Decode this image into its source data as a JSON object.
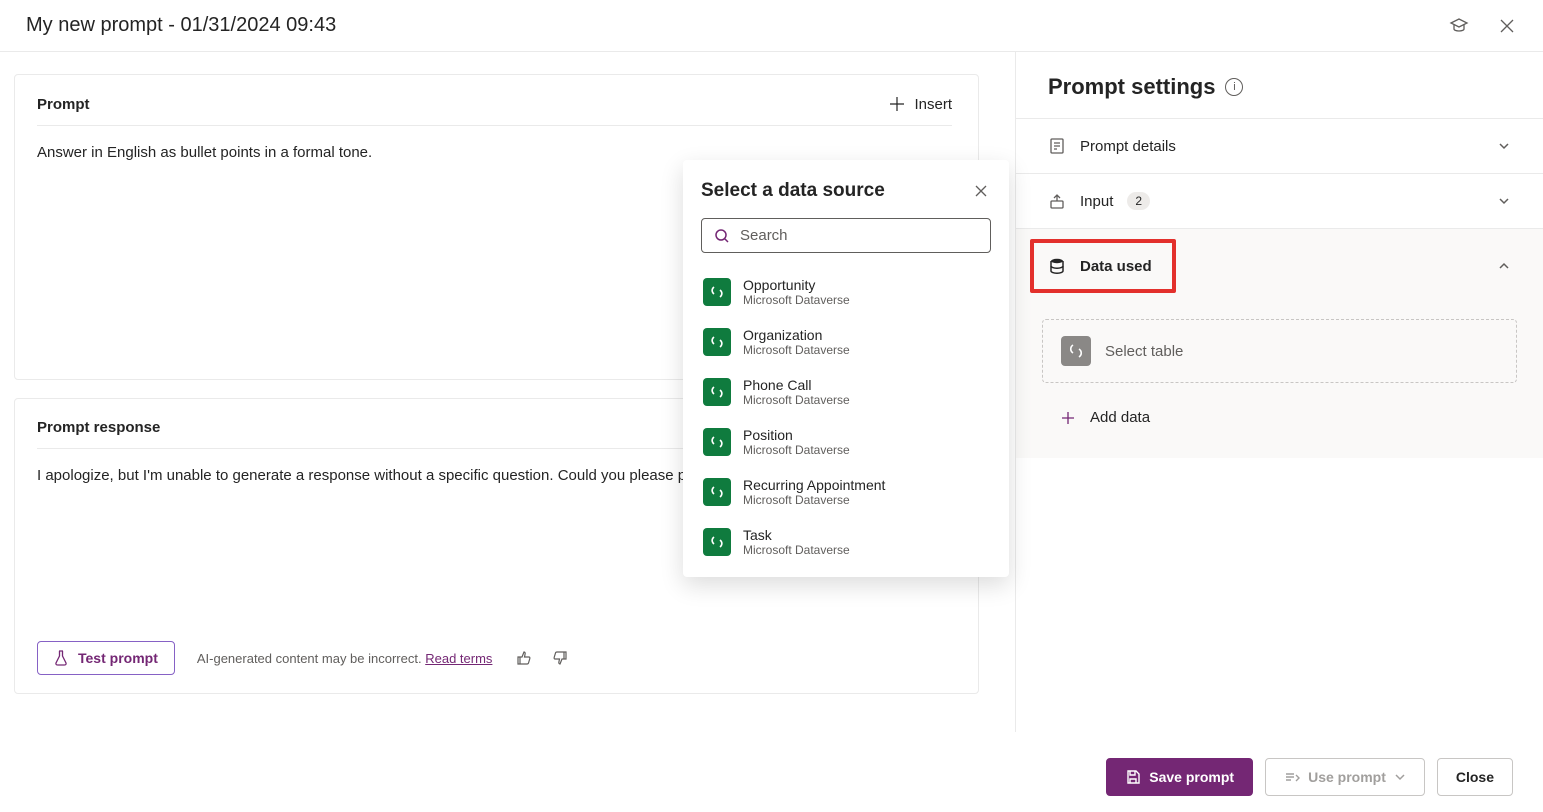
{
  "header": {
    "title": "My new prompt - 01/31/2024 09:43"
  },
  "prompt_section": {
    "title": "Prompt",
    "insert_label": "Insert",
    "text": "Answer in English as bullet points in a formal tone."
  },
  "response_section": {
    "title": "Prompt response",
    "text": "I apologize, but I'm unable to generate a response without a specific question. Could you please provide",
    "test_label": "Test prompt",
    "disclaimer": "AI-generated content may be incorrect.",
    "read_terms": "Read terms"
  },
  "settings": {
    "title": "Prompt settings",
    "details_label": "Prompt details",
    "input_label": "Input",
    "input_count": "2",
    "data_used_label": "Data used",
    "select_table_label": "Select table",
    "add_data_label": "Add data"
  },
  "popup": {
    "title": "Select a data source",
    "search_placeholder": "Search",
    "items": [
      {
        "name": "Opportunity",
        "sub": "Microsoft Dataverse"
      },
      {
        "name": "Organization",
        "sub": "Microsoft Dataverse"
      },
      {
        "name": "Phone Call",
        "sub": "Microsoft Dataverse"
      },
      {
        "name": "Position",
        "sub": "Microsoft Dataverse"
      },
      {
        "name": "Recurring Appointment",
        "sub": "Microsoft Dataverse"
      },
      {
        "name": "Task",
        "sub": "Microsoft Dataverse"
      }
    ]
  },
  "footer": {
    "save_label": "Save prompt",
    "use_label": "Use prompt",
    "close_label": "Close"
  }
}
